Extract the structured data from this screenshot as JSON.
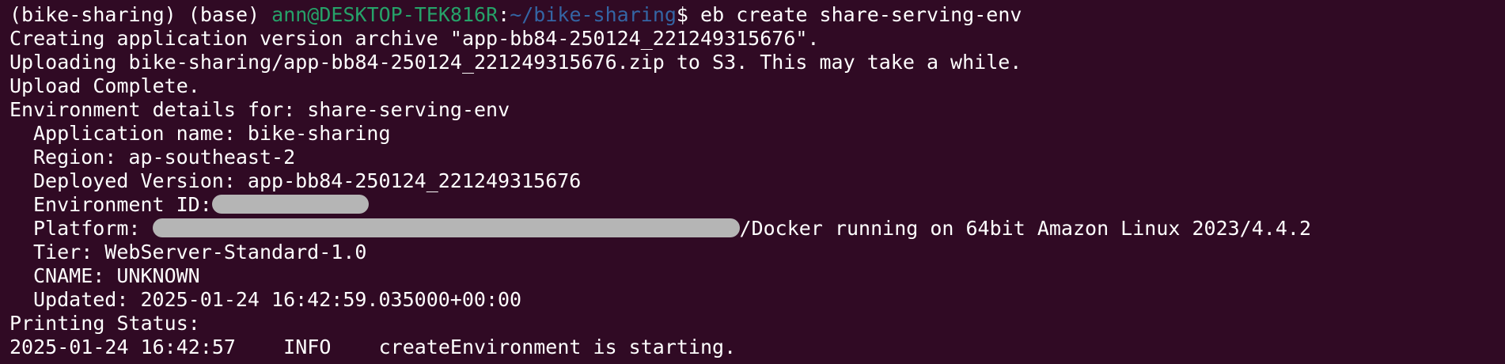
{
  "prompt": {
    "env1": "(bike-sharing)",
    "env2": "(base)",
    "user_host": "ann@DESKTOP-TEK816R",
    "separator": ":",
    "path": "~/bike-sharing",
    "symbol": "$",
    "command": "eb create share-serving-env"
  },
  "output": {
    "creating": "Creating application version archive \"app-bb84-250124_221249315676\".",
    "uploading": "Uploading bike-sharing/app-bb84-250124_221249315676.zip to S3. This may take a while.",
    "upload_complete": "Upload Complete.",
    "env_details": "Environment details for: share-serving-env",
    "app_name": "Application name: bike-sharing",
    "region": "Region: ap-southeast-2",
    "deployed_version": "Deployed Version: app-bb84-250124_221249315676",
    "env_id_label": "Environment ID:",
    "platform_label": "Platform:",
    "platform_suffix": "/Docker running on 64bit Amazon Linux 2023/4.4.2",
    "tier": "Tier: WebServer-Standard-1.0",
    "cname": "CNAME: UNKNOWN",
    "updated": "Updated: 2025-01-24 16:42:59.035000+00:00",
    "printing_status": "Printing Status:",
    "status_line": "2025-01-24 16:42:57    INFO    createEnvironment is starting."
  },
  "colors": {
    "background": "#300a24",
    "text": "#ffffff",
    "user_host": "#26a269",
    "path": "#3465a4",
    "redaction": "#b5b5b5"
  }
}
